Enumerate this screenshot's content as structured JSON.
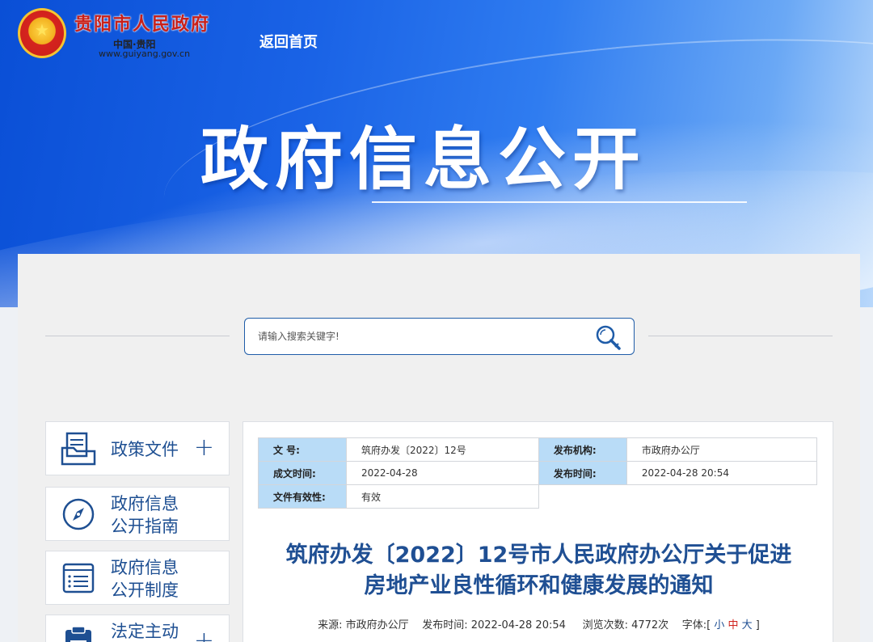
{
  "header": {
    "site_name": "贵阳市人民政府",
    "site_sub": "中国·贵阳",
    "site_url": "www.guiyang.gov.cn",
    "back_home": "返回首页",
    "hero_title": "政府信息公开"
  },
  "search": {
    "placeholder": "请输入搜索关键字!"
  },
  "sidebar": {
    "items": [
      {
        "label_line1": "政策文件",
        "label_line2": "",
        "has_plus": true,
        "icon": "folder-document-icon"
      },
      {
        "label_line1": "政府信息",
        "label_line2": "公开指南",
        "has_plus": false,
        "icon": "compass-icon"
      },
      {
        "label_line1": "政府信息",
        "label_line2": "公开制度",
        "has_plus": false,
        "icon": "list-document-icon"
      },
      {
        "label_line1": "法定主动",
        "label_line2": "",
        "has_plus": true,
        "icon": "clipboard-icon"
      }
    ]
  },
  "meta": {
    "doc_no_label": "文 号:",
    "doc_no": "筑府办发〔2022〕12号",
    "issuer_label": "发布机构:",
    "issuer": "市政府办公厅",
    "created_label": "成文时间:",
    "created": "2022-04-28",
    "published_label": "发布时间:",
    "published": "2022-04-28 20:54",
    "validity_label": "文件有效性:",
    "validity": "有效"
  },
  "doc": {
    "title_line1": "筑府办发〔2022〕12号市人民政府办公厅关于促进",
    "title_line2": "房地产业良性循环和健康发展的通知",
    "source_label": "来源:",
    "source": "市政府办公厅",
    "time_label": "发布时间:",
    "time": "2022-04-28 20:54",
    "views_label": "浏览次数:",
    "views": "4772次",
    "font_label": "字体:[",
    "font_small": "小",
    "font_mid": "中",
    "font_large": "大",
    "font_close": "]"
  },
  "colors": {
    "accent": "#1f4f93",
    "meta_key_bg": "#b9dcf7",
    "emblem_red": "#c8201a"
  }
}
